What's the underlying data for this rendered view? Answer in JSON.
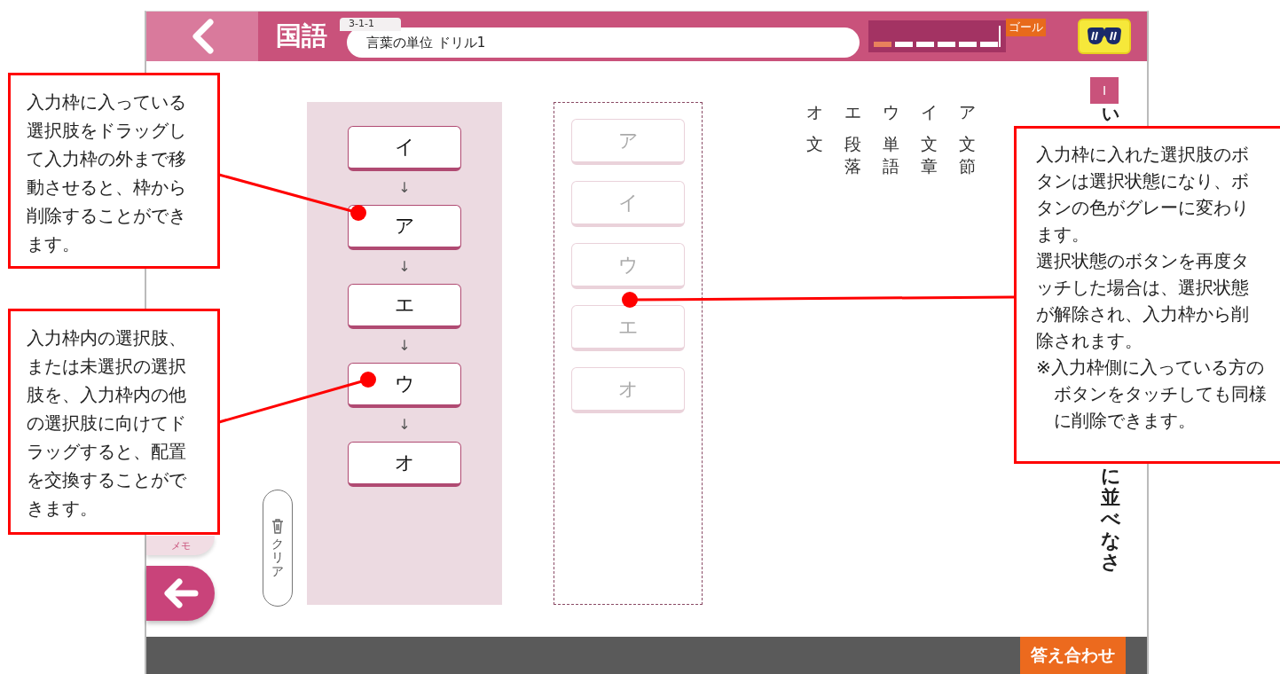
{
  "header": {
    "subject": "国語",
    "lesson_code": "3-1-1",
    "title": "言葉の単位 ドリル1",
    "goal_label": "ゴール",
    "progress_segments": [
      {
        "filled": true
      },
      {
        "filled": false
      },
      {
        "filled": false
      },
      {
        "filled": false
      },
      {
        "filled": false
      },
      {
        "filled": false
      }
    ]
  },
  "sidebar": {
    "memo_label": "メモ"
  },
  "clear_button": "クリア",
  "answer_slots": [
    {
      "label": "イ"
    },
    {
      "label": "ア"
    },
    {
      "label": "エ"
    },
    {
      "label": "ウ"
    },
    {
      "label": "オ"
    }
  ],
  "arrows": [
    "↓",
    "↓",
    "↓",
    "↓"
  ],
  "options": [
    {
      "label": "ア",
      "placed": true
    },
    {
      "label": "イ",
      "placed": true
    },
    {
      "label": "ウ",
      "placed": true
    },
    {
      "label": "エ",
      "placed": true
    },
    {
      "label": "オ",
      "placed": true
    }
  ],
  "choices": [
    {
      "letter": "オ",
      "word": "文"
    },
    {
      "letter": "エ",
      "word": "段落"
    },
    {
      "letter": "ウ",
      "word": "単語"
    },
    {
      "letter": "イ",
      "word": "文章"
    },
    {
      "letter": "ア",
      "word": "文節"
    }
  ],
  "question": {
    "number": "I",
    "text_top": "い",
    "text_bottom": "に並べなさ"
  },
  "footer": {
    "check_button": "答え合わせ"
  },
  "callouts": [
    {
      "paragraphs": [
        {
          "kind": "text",
          "text": "入力枠に入っている選択肢をドラッグして入力枠の外まで移動させると、枠から削除することができます。"
        }
      ]
    },
    {
      "paragraphs": [
        {
          "kind": "text",
          "text": "入力枠内の選択肢、または未選択の選択肢を、入力枠内の他の選択肢に向けてドラッグすると、配置を交換することができます。"
        }
      ]
    },
    {
      "paragraphs": [
        {
          "kind": "text",
          "text": "入力枠に入れた選択肢のボタンは選択状態になり、ボタンの色がグレーに変わります。"
        },
        {
          "kind": "text",
          "text": "選択状態のボタンを再度タッチした場合は、選択状態が解除され、入力枠から削除されます。"
        },
        {
          "kind": "note",
          "text": "※入力枠側に入っている方のボタンをタッチしても同様に削除できます。"
        }
      ]
    }
  ]
}
